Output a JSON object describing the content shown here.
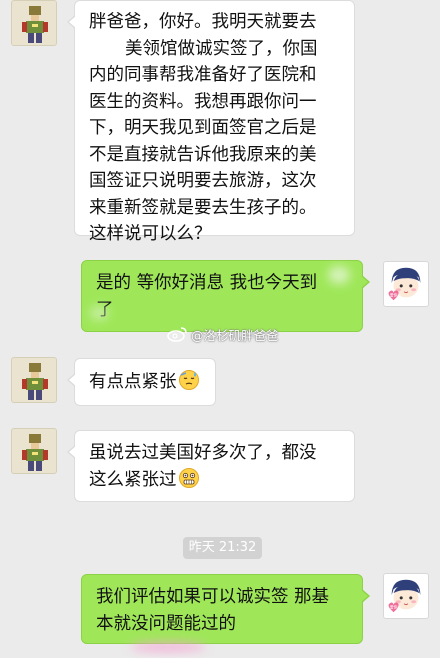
{
  "messages": [
    {
      "id": "m1",
      "direction": "incoming",
      "lines": [
        "胖爸爸，你好。我明天就要去",
        "美领馆做诚实签了，你国",
        "内的同事帮我准备好了医院和",
        "医生的资料。我想再跟你问一",
        "下，明天我见到面签官之后是",
        "不是直接就告诉他我原来的美",
        "国签证只说明要去旅游，这次",
        "来重新签就是要去生孩子的。",
        "这样说可以么？"
      ]
    },
    {
      "id": "m2",
      "direction": "outgoing",
      "lines": [
        "是的 等你好消息 我也今天到",
        "了"
      ]
    },
    {
      "id": "m3",
      "direction": "incoming",
      "text": "有点点紧张",
      "emoji": "sweat-face-icon"
    },
    {
      "id": "m4",
      "direction": "incoming",
      "lines": [
        "虽说去过美国好多次了，都没",
        "这么紧张过"
      ],
      "emoji": "grimace-face-icon"
    },
    {
      "id": "m5",
      "direction": "outgoing",
      "lines": [
        "我们评估如果可以诚实签 那基",
        "本就没问题能过的"
      ]
    }
  ],
  "timestamp": "昨天 21:32",
  "watermark": "@洛杉矶胖爸爸",
  "avatars": {
    "left": "pixel-character-avatar",
    "right": "cartoon-boy-avatar",
    "right_badge": "爱你の"
  },
  "colors": {
    "background": "#ebebeb",
    "incoming_bubble": "#ffffff",
    "outgoing_bubble": "#9fe759",
    "timestamp_bg": "#d2d2d2"
  }
}
